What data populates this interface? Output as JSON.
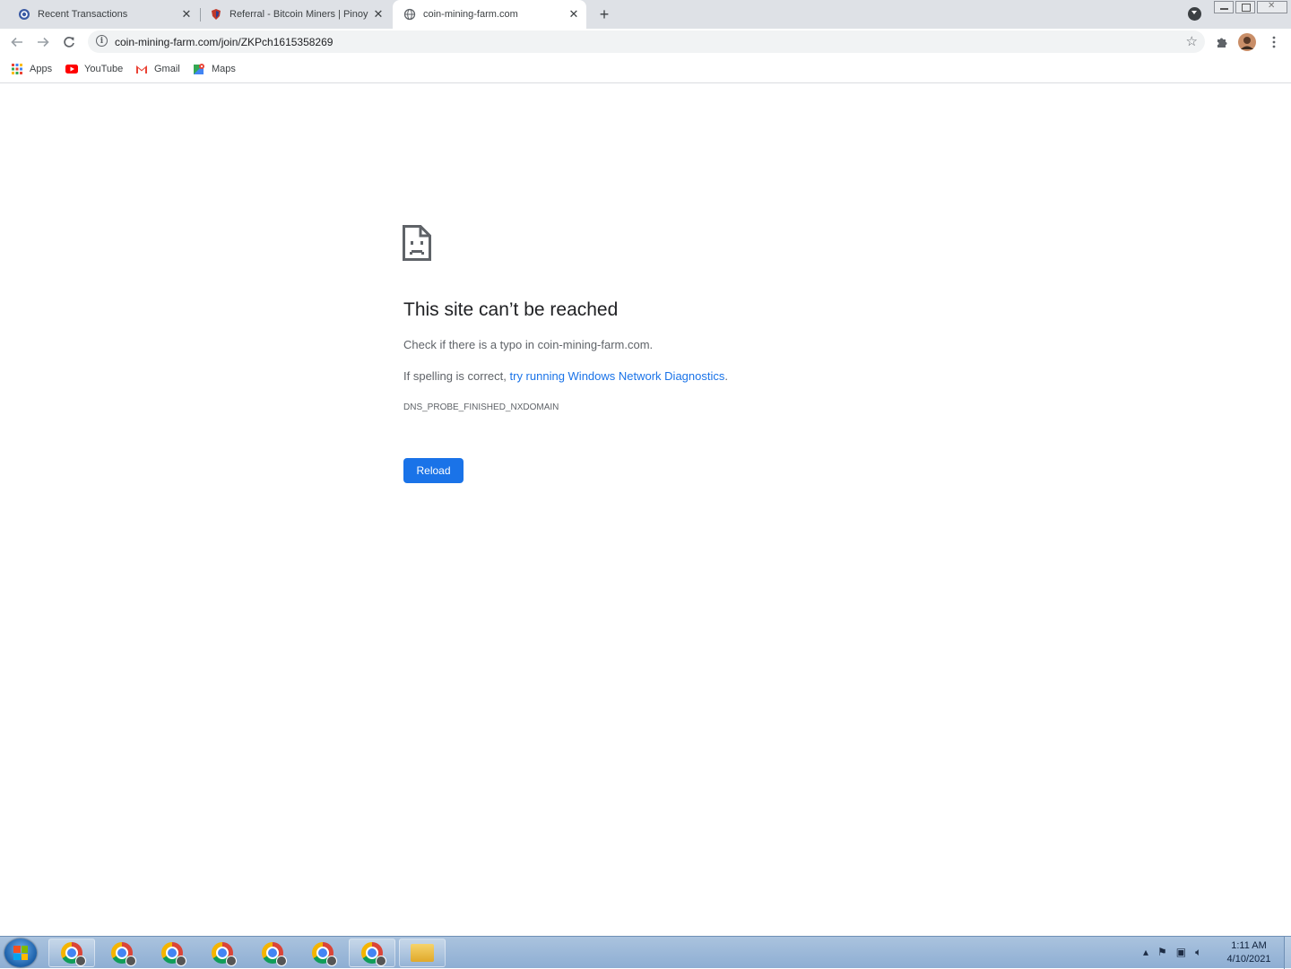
{
  "tabs": [
    {
      "title": "Recent Transactions",
      "favicon": "coin-favicon",
      "active": false
    },
    {
      "title": "Referral - Bitcoin Miners | Pinoy I",
      "favicon": "shield-favicon",
      "active": false
    },
    {
      "title": "coin-mining-farm.com",
      "favicon": "globe-favicon",
      "active": true
    }
  ],
  "toolbar": {
    "url": "coin-mining-farm.com/join/ZKPch1615358269"
  },
  "bookmarks": [
    {
      "label": "Apps",
      "icon": "apps-grid-icon"
    },
    {
      "label": "YouTube",
      "icon": "youtube-icon"
    },
    {
      "label": "Gmail",
      "icon": "gmail-icon"
    },
    {
      "label": "Maps",
      "icon": "maps-icon"
    }
  ],
  "error": {
    "heading": "This site can’t be reached",
    "line1": "Check if there is a typo in coin-mining-farm.com.",
    "line2_prefix": "If spelling is correct, ",
    "line2_link": "try running Windows Network Diagnostics",
    "line2_suffix": ".",
    "code": "DNS_PROBE_FINISHED_NXDOMAIN",
    "reload_label": "Reload"
  },
  "taskbar": {
    "clock_time": "1:11 AM",
    "clock_date": "4/10/2021"
  },
  "colors": {
    "accent": "#1a73e8",
    "tabstrip": "#dee1e6",
    "text_secondary": "#5f6368"
  }
}
